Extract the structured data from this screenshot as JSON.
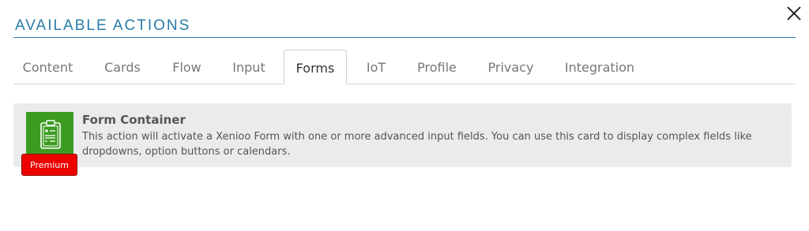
{
  "dialog": {
    "title": "AVAILABLE ACTIONS"
  },
  "tabs": [
    {
      "label": "Content"
    },
    {
      "label": "Cards"
    },
    {
      "label": "Flow"
    },
    {
      "label": "Input"
    },
    {
      "label": "Forms"
    },
    {
      "label": "IoT"
    },
    {
      "label": "Profile"
    },
    {
      "label": "Privacy"
    },
    {
      "label": "Integration"
    }
  ],
  "active_tab": "Forms",
  "actions": [
    {
      "title": "Form Container",
      "description": "This action will activate a Xenioo Form with one or more advanced input fields. You can use this card to display complex fields like dropdowns, option buttons or calendars.",
      "icon": "clipboard-form-icon",
      "badge": "Premium"
    }
  ],
  "colors": {
    "accent": "#2a7ca8",
    "icon_bg": "#3d9b22",
    "badge_bg": "#ee0000",
    "card_bg": "#ebebeb"
  }
}
